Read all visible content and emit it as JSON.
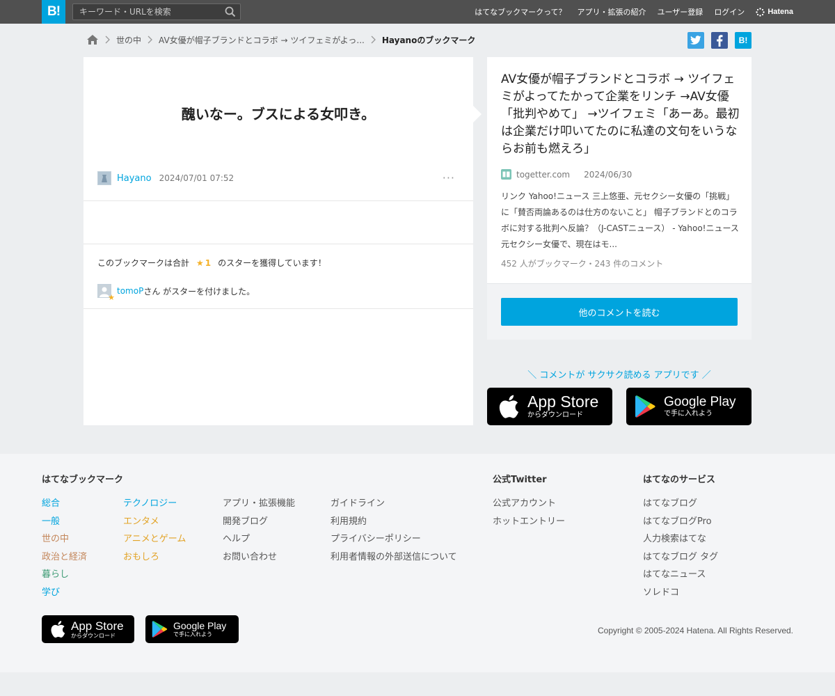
{
  "header": {
    "logo_text": "B!",
    "search_placeholder": "キーワード・URLを検索",
    "nav": [
      "はてなブックマークって？",
      "アプリ・拡張の紹介",
      "ユーザー登録",
      "ログイン"
    ],
    "brand": "Hatena"
  },
  "breadcrumb": {
    "items": [
      "世の中",
      "AV女優が帽子ブランドとコラボ → ツイフェミがよっ..."
    ],
    "current": "Hayanoのブックマーク"
  },
  "share": {
    "hatena_label": "B!"
  },
  "bookmark": {
    "comment": "醜いなー。ブスによる女叩き。",
    "user": "Hayano",
    "timestamp": "2024/07/01 07:52",
    "more": "···",
    "star_text_before": "このブックマークは合計",
    "star_glyph": "★",
    "star_count": "1",
    "star_text_after": "のスターを獲得しています！",
    "star_user": "tomoP",
    "star_user_text": "さん がスターを付けました。"
  },
  "entry": {
    "title": "AV女優が帽子ブランドとコラボ → ツイフェミがよってたかって企業をリンチ →AV女優「批判やめて」 →ツイフェミ「あーあ。最初は企業だけ叩いてたのに私達の文句をいうならお前も燃えろ」",
    "domain": "togetter.com",
    "date": "2024/06/30",
    "description": "リンク Yahoo!ニュース 三上悠亜、元セクシー女優の「挑戦」に「賛否両論あるのは仕方のないこと」 帽子ブランドとのコラボに対する批判へ反論？（J-CASTニュース） - Yahoo!ニュース 元セクシー女優で、現在はモ...",
    "stats": "452 人がブックマーク・243 件のコメント",
    "read_button": "他のコメントを読む"
  },
  "promo": {
    "tagline": "＼ コメントが サクサク読める アプリです ／",
    "appstore_big": "App Store",
    "appstore_small": "からダウンロード",
    "googleplay_big": "Google Play",
    "googleplay_small": "で手に入れよう"
  },
  "footer": {
    "col1_title": "はてなブックマーク",
    "categories_a": [
      {
        "label": "総合",
        "color": "#00a4de"
      },
      {
        "label": "一般",
        "color": "#00a4de"
      },
      {
        "label": "世の中",
        "color": "#c3865a"
      },
      {
        "label": "政治と経済",
        "color": "#c3865a"
      },
      {
        "label": "暮らし",
        "color": "#3d9b74"
      },
      {
        "label": "学び",
        "color": "#00a4de"
      }
    ],
    "categories_b": [
      {
        "label": "テクノロジー",
        "color": "#00a4de"
      },
      {
        "label": "エンタメ",
        "color": "#e2a326"
      },
      {
        "label": "アニメとゲーム",
        "color": "#e2a326"
      },
      {
        "label": "おもしろ",
        "color": "#e2a326"
      }
    ],
    "links_c": [
      "アプリ・拡張機能",
      "開発ブログ",
      "ヘルプ",
      "お問い合わせ"
    ],
    "links_d": [
      "ガイドライン",
      "利用規約",
      "プライバシーポリシー",
      "利用者情報の外部送信について"
    ],
    "twitter_title": "公式Twitter",
    "twitter_links": [
      "公式アカウント",
      "ホットエントリー"
    ],
    "services_title": "はてなのサービス",
    "services": [
      "はてなブログ",
      "はてなブログPro",
      "人力検索はてな",
      "はてなブログ タグ",
      "はてなニュース",
      "ソレドコ"
    ],
    "copyright": "Copyright © 2005-2024 Hatena. All Rights Reserved."
  },
  "colors": {
    "accent": "#00a4de",
    "topbar": "#505050",
    "star": "#f4b128",
    "twitter": "#1da1f2",
    "facebook": "#3b5998"
  }
}
